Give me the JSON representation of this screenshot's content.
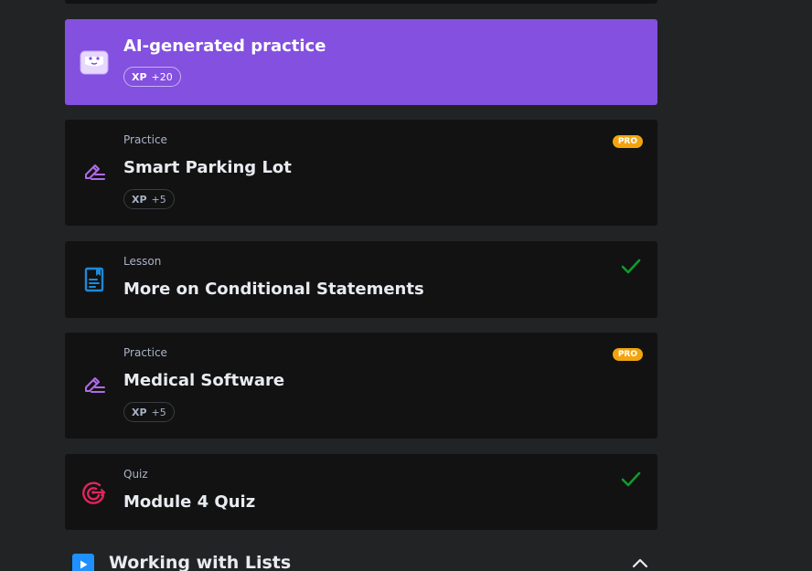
{
  "cards": {
    "ai": {
      "title": "AI-generated practice",
      "xp_label": "XP",
      "xp_value": "+20",
      "icon": "robot-box-icon",
      "color": "#8350df"
    },
    "parking": {
      "category": "Practice",
      "title": "Smart Parking Lot",
      "xp_label": "XP",
      "xp_value": "+5",
      "pro": "PRO",
      "icon": "pencil-lines-icon"
    },
    "conditional": {
      "category": "Lesson",
      "title": "More on Conditional Statements",
      "icon": "document-bookmark-icon",
      "completed": true
    },
    "medical": {
      "category": "Practice",
      "title": "Medical Software",
      "xp_label": "XP",
      "xp_value": "+5",
      "pro": "PRO",
      "icon": "pencil-lines-icon"
    },
    "quiz": {
      "category": "Quiz",
      "title": "Module 4 Quiz",
      "icon": "target-arrow-icon",
      "completed": true
    }
  },
  "section": {
    "title": "Working with Lists",
    "icon": "play-icon",
    "expanded": true
  },
  "colors": {
    "background": "#222325",
    "card": "#121212",
    "accent_purple": "#8350df",
    "pro": "#f3a40d",
    "check": "#0e9c2b",
    "lesson_icon": "#1d8ad8",
    "quiz_icon": "#e0245e"
  }
}
